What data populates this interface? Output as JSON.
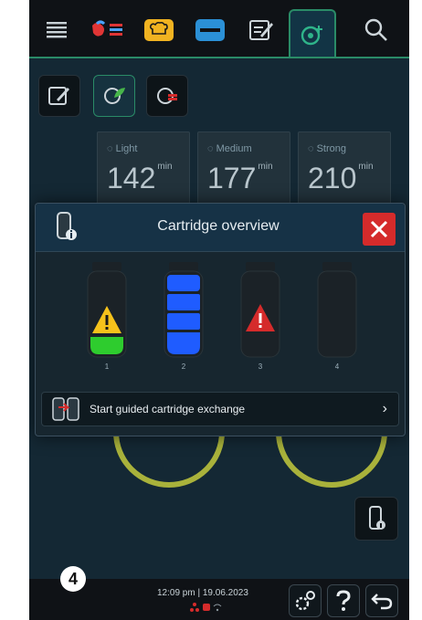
{
  "topbar": {
    "tabs": [
      {
        "icon": "menu-lines-icon"
      },
      {
        "icon": "cooking-modes-icon"
      },
      {
        "icon": "chef-hat-icon"
      },
      {
        "icon": "program-list-icon"
      },
      {
        "icon": "edit-note-icon"
      },
      {
        "icon": "care-cleaning-icon"
      },
      {
        "icon": "search-icon"
      }
    ]
  },
  "toolbar": {
    "buttons": [
      "edit-icon",
      "care-leaf-icon",
      "care-plus-icon"
    ]
  },
  "programs": [
    {
      "label": "Light",
      "value": "142",
      "unit": "min"
    },
    {
      "label": "Medium",
      "value": "177",
      "unit": "min"
    },
    {
      "label": "Strong",
      "value": "210",
      "unit": "min"
    }
  ],
  "modal": {
    "title": "Cartridge overview",
    "cartridges": [
      {
        "number": "1",
        "status": "warning",
        "fill_color": "#2ecc2e"
      },
      {
        "number": "2",
        "status": "full",
        "fill_color": "#1f5cff"
      },
      {
        "number": "3",
        "status": "error",
        "fill_color": "#d52b2b"
      },
      {
        "number": "4",
        "status": "empty",
        "fill_color": "#1c252b"
      }
    ],
    "exchange_label": "Start guided cartridge exchange",
    "exchange_chevron": "›"
  },
  "bottombar": {
    "time": "12:09 pm",
    "separator": "|",
    "date": "19.06.2023"
  },
  "badge": {
    "step": "4"
  },
  "colors": {
    "accent": "#2a8b67",
    "danger": "#d52b2b",
    "ring": "#a9b23b"
  }
}
